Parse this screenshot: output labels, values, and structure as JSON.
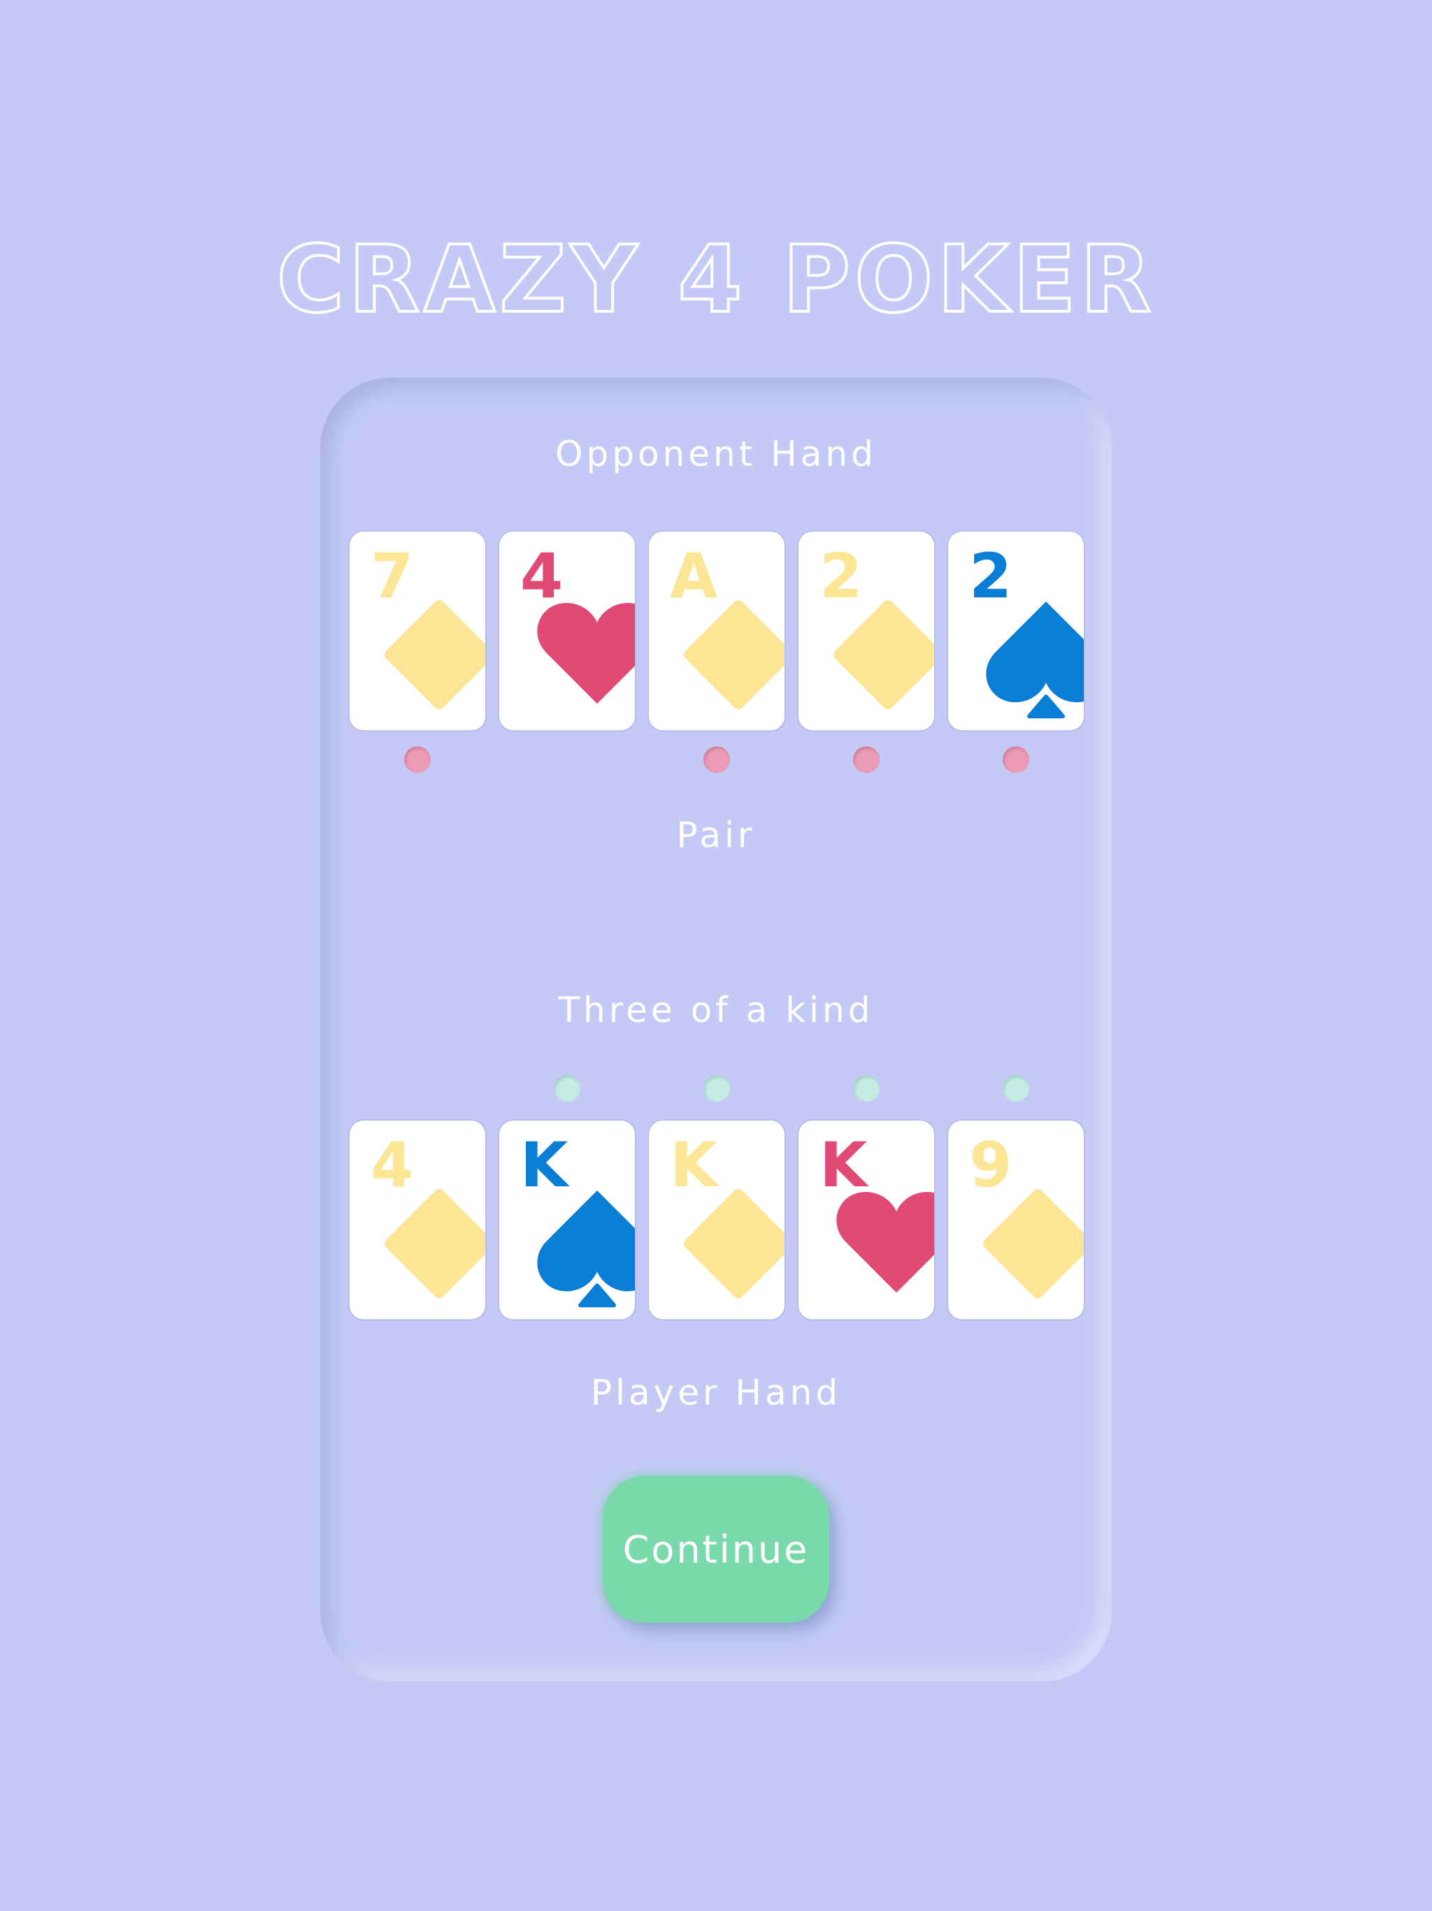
{
  "title": "CRAZY 4 POKER",
  "opponent": {
    "heading": "Opponent Hand",
    "result": "Pair",
    "cards": [
      {
        "rank": "7",
        "suit": "diamond",
        "color": "#fde596",
        "marked": true
      },
      {
        "rank": "4",
        "suit": "heart",
        "color": "#e14a75",
        "marked": false
      },
      {
        "rank": "A",
        "suit": "diamond",
        "color": "#fde596",
        "marked": true
      },
      {
        "rank": "2",
        "suit": "diamond",
        "color": "#fde596",
        "marked": true
      },
      {
        "rank": "2",
        "suit": "spade",
        "color": "#0a7ed6",
        "marked": true
      }
    ]
  },
  "player": {
    "heading": "Player Hand",
    "result": "Three of a kind",
    "cards": [
      {
        "rank": "4",
        "suit": "diamond",
        "color": "#fde596",
        "marked": false
      },
      {
        "rank": "K",
        "suit": "spade",
        "color": "#0a7ed6",
        "marked": true
      },
      {
        "rank": "K",
        "suit": "diamond",
        "color": "#fde596",
        "marked": true
      },
      {
        "rank": "K",
        "suit": "heart",
        "color": "#e14a75",
        "marked": true
      },
      {
        "rank": "9",
        "suit": "diamond",
        "color": "#fde596",
        "marked": true
      }
    ]
  },
  "continue_label": "Continue"
}
